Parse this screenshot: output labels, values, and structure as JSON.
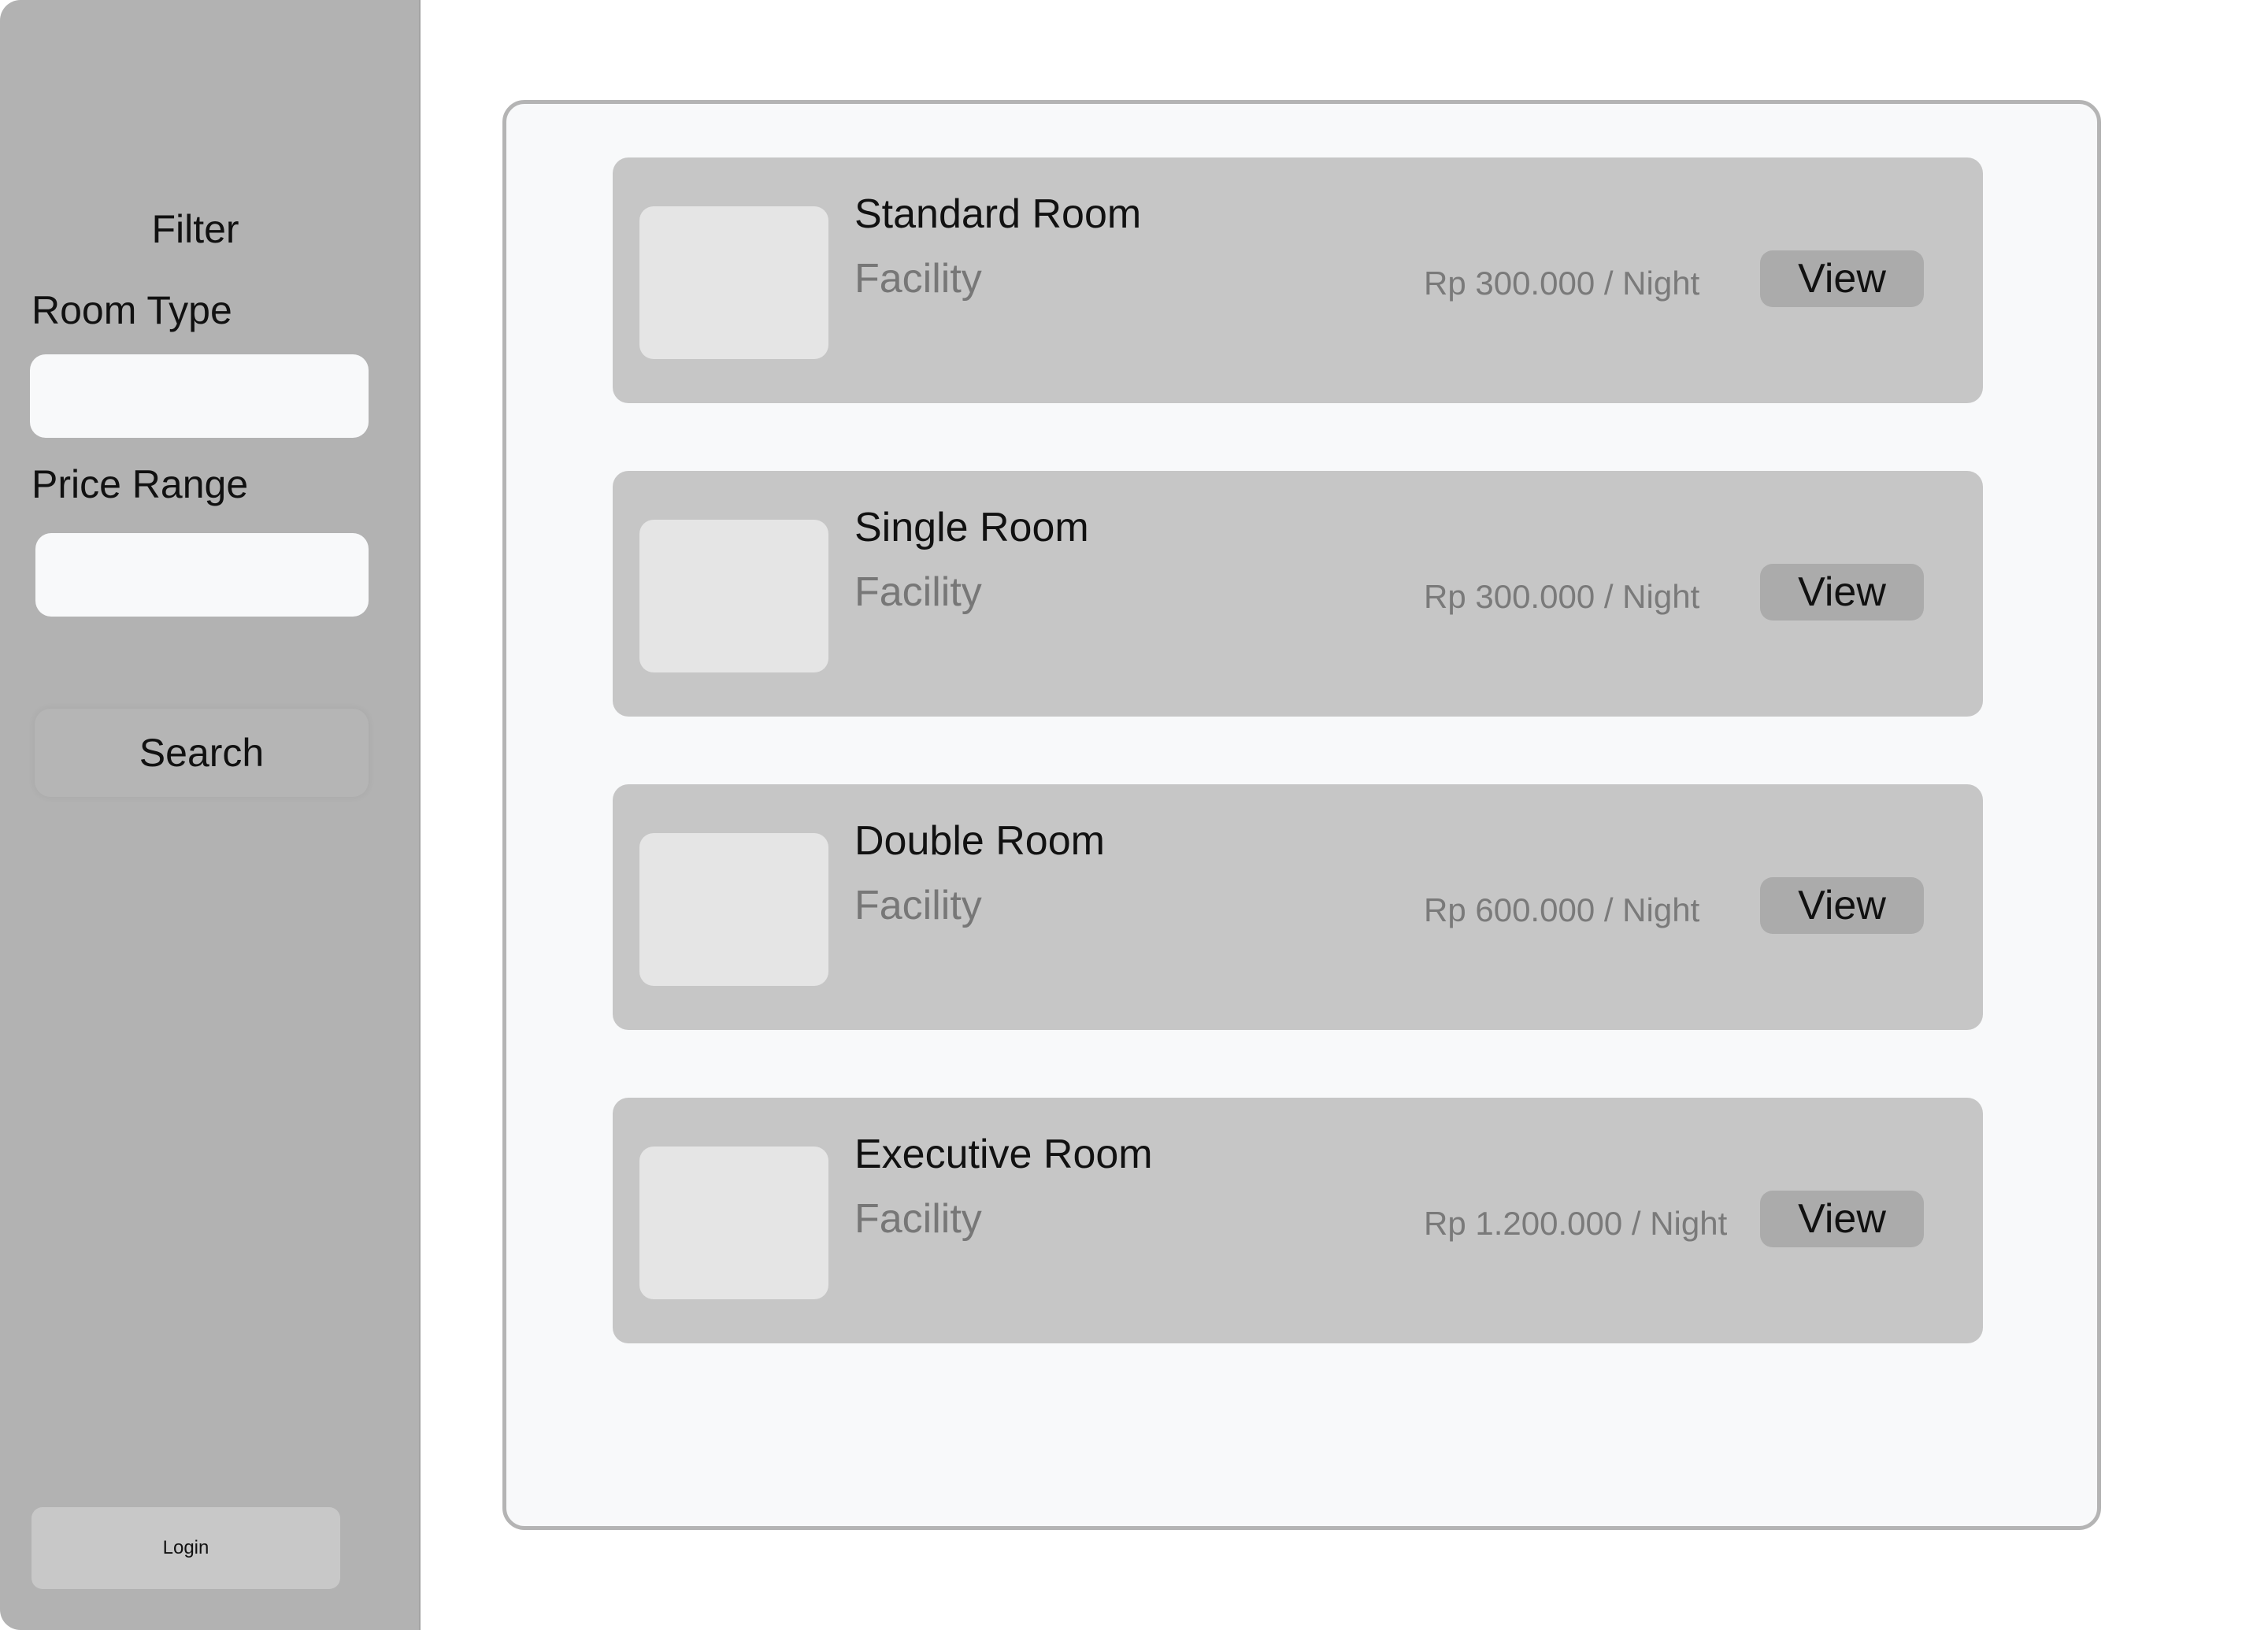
{
  "sidebar": {
    "filter_title": "Filter",
    "room_type_label": "Room Type",
    "room_type_value": "",
    "price_range_label": "Price Range",
    "price_range_value": "",
    "search_label": "Search",
    "login_label": "Login"
  },
  "rooms": [
    {
      "name": "Standard Room",
      "facility": "Facility",
      "price": "Rp 300.000 / Night",
      "view_label": "View"
    },
    {
      "name": "Single Room",
      "facility": "Facility",
      "price": "Rp 300.000 / Night",
      "view_label": "View"
    },
    {
      "name": "Double Room",
      "facility": "Facility",
      "price": "Rp 600.000 / Night",
      "view_label": "View"
    },
    {
      "name": "Executive Room",
      "facility": "Facility",
      "price": "Rp 1.200.000 / Night",
      "view_label": "View"
    }
  ],
  "colors": {
    "sidebar_bg": "#b2b2b2",
    "panel_bg": "#f8f9fa",
    "card_bg": "#c6c6c6",
    "button_bg": "#ababab"
  }
}
